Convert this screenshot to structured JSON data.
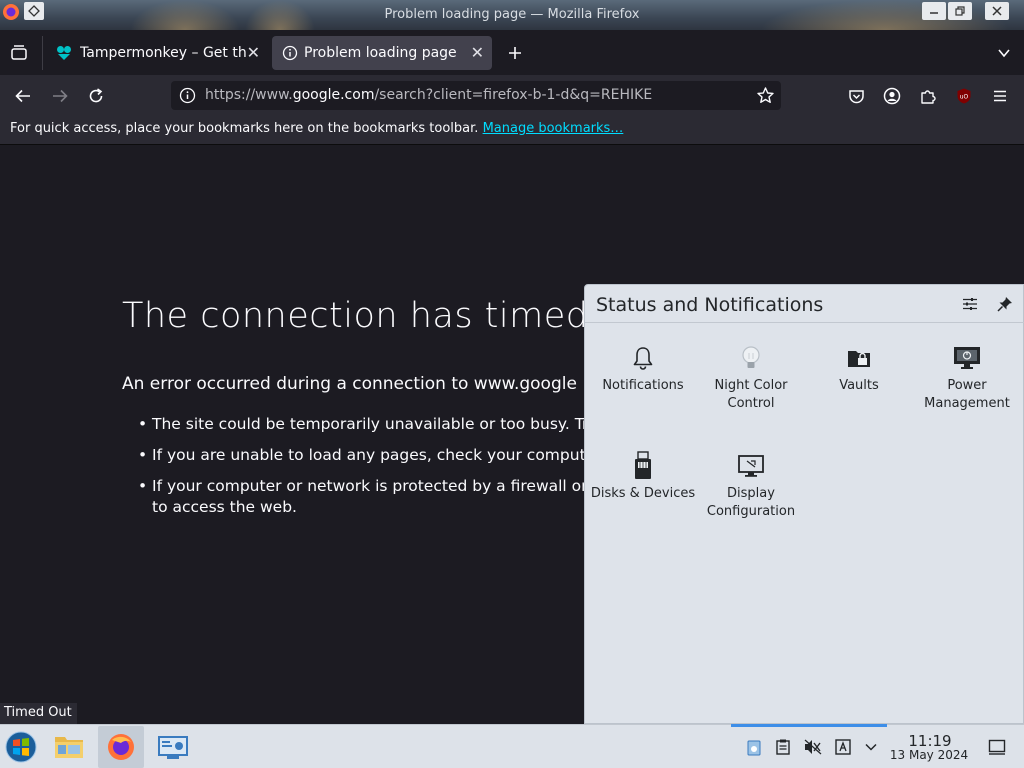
{
  "window": {
    "title": "Problem loading page — Mozilla Firefox"
  },
  "tabs": [
    {
      "label": "Tampermonkey – Get thi",
      "icon": "tampermonkey-icon",
      "active": false
    },
    {
      "label": "Problem loading page",
      "icon": "info-icon",
      "active": true
    }
  ],
  "navbar": {
    "url_prefix": "https://www.",
    "url_domain": "google.com",
    "url_suffix": "/search?client=firefox-b-1-d&q=REHIKE"
  },
  "bookmarks_bar": {
    "text": "For quick access, place your bookmarks here on the bookmarks toolbar.",
    "link": "Manage bookmarks…"
  },
  "error_page": {
    "title": "The connection has timed o",
    "description": "An error occurred during a connection to www.google",
    "items": [
      "The site could be temporarily unavailable or too busy. Try",
      "If you are unable to load any pages, check your computer",
      "If your computer or network is protected by a firewall or p",
      "to access the web."
    ]
  },
  "popup": {
    "title": "Status and Notifications",
    "applets": [
      {
        "label": "Notifications",
        "icon": "bell-icon"
      },
      {
        "label": "Night Color Control",
        "icon": "lightbulb-icon"
      },
      {
        "label": "Vaults",
        "icon": "vault-lock-icon"
      },
      {
        "label": "Power Management",
        "icon": "power-management-icon"
      },
      {
        "label": "Disks & Devices",
        "icon": "usb-drive-icon"
      },
      {
        "label": "Display Configuration",
        "icon": "display-icon"
      }
    ]
  },
  "tooltip": {
    "text": "Timed Out"
  },
  "taskbar": {
    "apps": [
      "start-menu-icon",
      "file-manager-icon",
      "firefox-icon",
      "system-settings-icon"
    ],
    "clock_time": "11:19",
    "clock_date": "13 May 2024"
  },
  "colors": {
    "accent_link": "#00ddff",
    "popup_bg": "#dee3ea",
    "browser_bg": "#1c1b22",
    "toolbar_bg": "#2b2a33"
  }
}
